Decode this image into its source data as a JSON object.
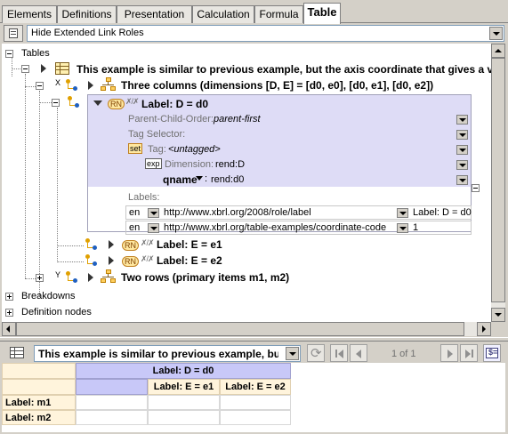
{
  "tabs": [
    "Elements",
    "Definitions",
    "Presentation",
    "Calculation",
    "Formula",
    "Table"
  ],
  "active_tab": "Table",
  "toolbar": {
    "link_roles_value": "Hide Extended Link Roles"
  },
  "tree": {
    "root_label": "Tables",
    "table_title": "This example is similar to previous example, but the axis coordinate that gives a valu",
    "x_axis": "X",
    "y_axis": "Y",
    "columns_node": "Three columns (dimensions [D, E] = [d0, e0], [d0, e1], [d0, e2])",
    "rn_badge": "RN",
    "node_d0": "Label: D = d0",
    "parent_child_order_label": "Parent-Child-Order:",
    "parent_child_order_value": "parent-first",
    "tag_selector_label": "Tag Selector:",
    "set_badge": "set",
    "tag_label": "Tag:",
    "tag_value": "<untagged>",
    "exp_badge": "exp",
    "dimension_label": "Dimension:",
    "dimension_value": "rend:D",
    "qname_label": "qname",
    "qname_value": "rend:d0",
    "labels_header": "Labels:",
    "label_rows": [
      {
        "lang": "en",
        "role": "http://www.xbrl.org/2008/role/label",
        "text": "Label: D = d0"
      },
      {
        "lang": "en",
        "role": "http://www.xbrl.org/table-examples/coordinate-code",
        "text": "1"
      }
    ],
    "node_e1": "Label: E = e1",
    "node_e2": "Label: E = e2",
    "rows_node": "Two rows (primary items m1, m2)",
    "breakdowns": "Breakdowns",
    "definition_nodes": "Definition nodes"
  },
  "preview": {
    "table_select": "This example is similar to previous example, but th",
    "page_info": "1 of 1",
    "header_top": "Label: D = d0",
    "col_e1": "Label: E = e1",
    "col_e2": "Label: E = e2",
    "row_m1": "Label: m1",
    "row_m2": "Label: m2"
  },
  "colors": {
    "panel_bg": "#dedcf6",
    "header_bg": "#c8c8f8",
    "cell_bg": "#fff4dc",
    "badge": "#ffe8a0"
  }
}
